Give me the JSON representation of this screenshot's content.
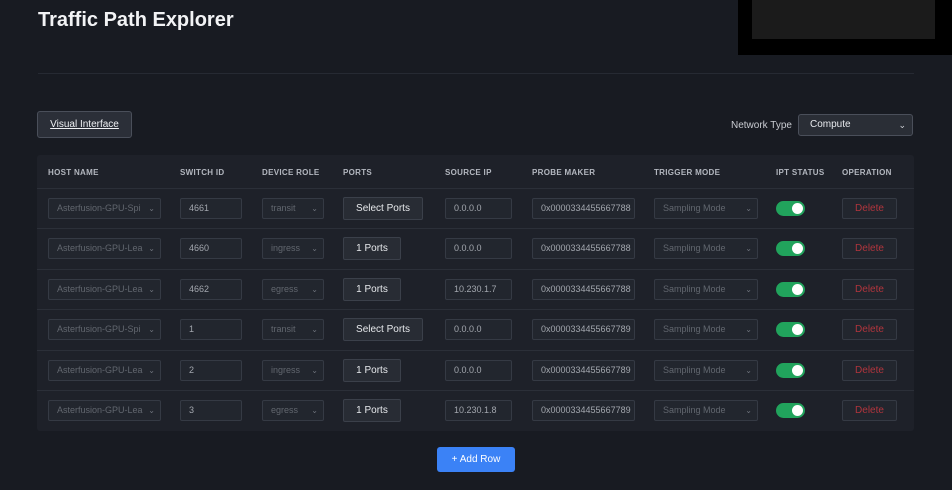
{
  "app": {
    "title": "Traffic Path Explorer"
  },
  "toolbar": {
    "visual_interface_label": "Visual Interface",
    "network_type_label": "Network Type",
    "network_type_value": "Compute"
  },
  "table": {
    "headers": [
      "HOST NAME",
      "SWITCH ID",
      "DEVICE ROLE",
      "PORTS",
      "SOURCE IP",
      "PROBE MAKER",
      "TRIGGER MODE",
      "IPT STATUS",
      "OPERATION"
    ],
    "rows": [
      {
        "host": "Asterfusion-GPU-Spi",
        "switch_id": "4661",
        "role": "transit",
        "ports": "Select Ports",
        "source_ip": "0.0.0.0",
        "probe": "0x0000334455667788",
        "trigger": "Sampling Mode",
        "ipt_on": true,
        "op": "Delete"
      },
      {
        "host": "Asterfusion-GPU-Lea",
        "switch_id": "4660",
        "role": "ingress",
        "ports": "1 Ports",
        "source_ip": "0.0.0.0",
        "probe": "0x0000334455667788",
        "trigger": "Sampling Mode",
        "ipt_on": true,
        "op": "Delete"
      },
      {
        "host": "Asterfusion-GPU-Lea",
        "switch_id": "4662",
        "role": "egress",
        "ports": "1 Ports",
        "source_ip": "10.230.1.7",
        "probe": "0x0000334455667788",
        "trigger": "Sampling Mode",
        "ipt_on": true,
        "op": "Delete"
      },
      {
        "host": "Asterfusion-GPU-Spi",
        "switch_id": "1",
        "role": "transit",
        "ports": "Select Ports",
        "source_ip": "0.0.0.0",
        "probe": "0x0000334455667789",
        "trigger": "Sampling Mode",
        "ipt_on": true,
        "op": "Delete"
      },
      {
        "host": "Asterfusion-GPU-Lea",
        "switch_id": "2",
        "role": "ingress",
        "ports": "1 Ports",
        "source_ip": "0.0.0.0",
        "probe": "0x0000334455667789",
        "trigger": "Sampling Mode",
        "ipt_on": true,
        "op": "Delete"
      },
      {
        "host": "Asterfusion-GPU-Lea",
        "switch_id": "3",
        "role": "egress",
        "ports": "1 Ports",
        "source_ip": "10.230.1.8",
        "probe": "0x0000334455667789",
        "trigger": "Sampling Mode",
        "ipt_on": true,
        "op": "Delete"
      }
    ]
  },
  "footer": {
    "add_row_label": "+ Add Row"
  },
  "colors": {
    "accent": "#3b82f6",
    "toggle_on": "#21a35c",
    "danger": "#b2353d",
    "background": "#181b22"
  },
  "icons": {
    "dropdown": "chevron-down-icon"
  }
}
